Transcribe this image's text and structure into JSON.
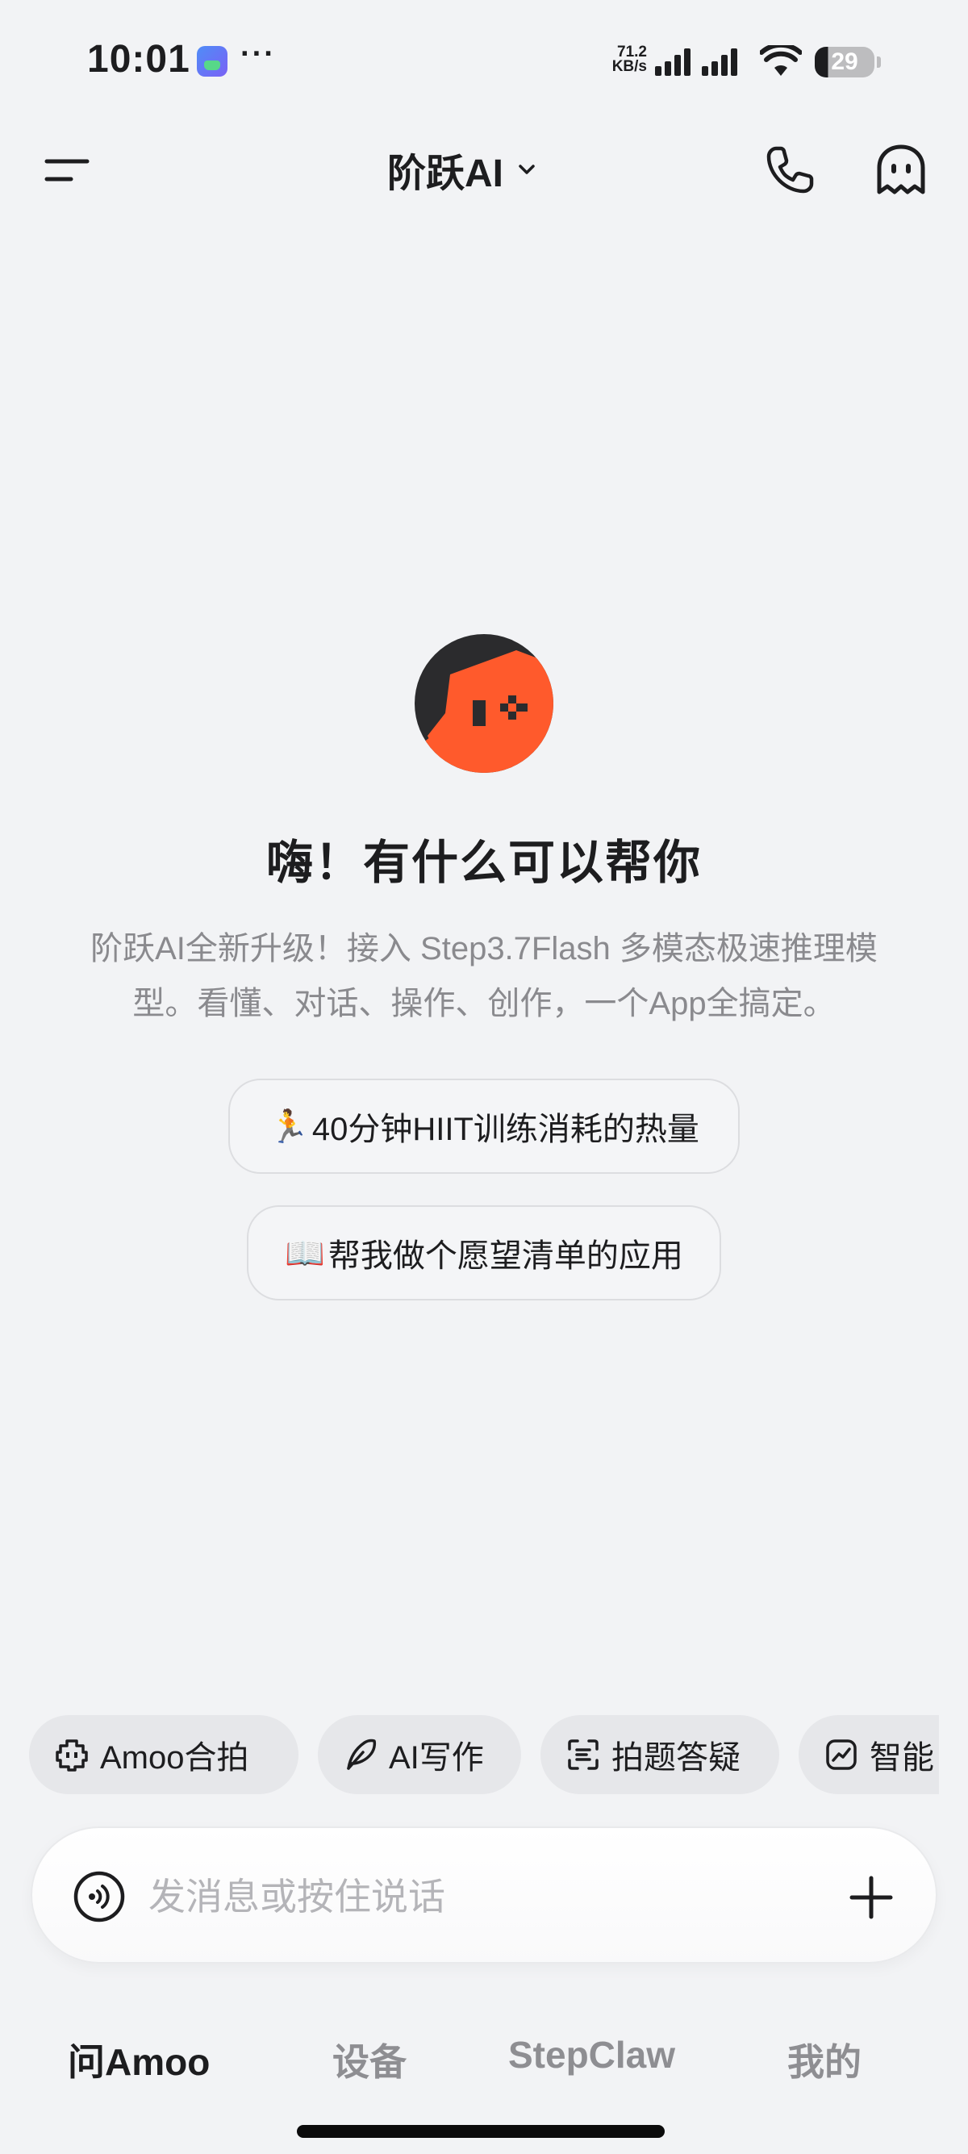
{
  "status_bar": {
    "time": "10:01",
    "more": "···",
    "net_speed_value": "71.2",
    "net_speed_unit": "KB/s",
    "battery": "29",
    "icons": [
      "gallery-app-icon",
      "signal-icon",
      "wifi-icon",
      "battery-icon"
    ]
  },
  "header": {
    "title": "阶跃AI",
    "icons": [
      "menu-icon",
      "chevron-down-icon",
      "phone-icon",
      "ghost-icon"
    ]
  },
  "hero": {
    "greeting": "嗨！有什么可以帮你",
    "intro": "阶跃AI全新升级！接入 Step3.7Flash 多模态极速推理模型。看懂、对话、操作、创作，一个App全搞定。",
    "suggestions": [
      {
        "emoji": "🏃",
        "text": "40分钟HIIT训练消耗的热量"
      },
      {
        "emoji": "📖",
        "text": "帮我做个愿望清单的应用"
      }
    ]
  },
  "quick_actions": [
    {
      "label": "Amoo合拍",
      "icon": "amoo-icon"
    },
    {
      "label": "AI写作",
      "icon": "feather-pen-icon"
    },
    {
      "label": "拍题答疑",
      "icon": "scan-icon"
    },
    {
      "label": "智能",
      "icon": "chart-icon"
    }
  ],
  "input": {
    "placeholder": "发消息或按住说话",
    "value": ""
  },
  "tabs": [
    {
      "label": "问Amoo",
      "active": true
    },
    {
      "label": "设备",
      "active": false
    },
    {
      "label": "StepClaw",
      "active": false
    },
    {
      "label": "我的",
      "active": false
    }
  ],
  "colors": {
    "background": "#f2f3f5",
    "avatar_orange": "#ff5a2c",
    "avatar_dark": "#2b2b2d",
    "text_primary": "#1d1d1f",
    "text_secondary": "#8a8a8e"
  }
}
